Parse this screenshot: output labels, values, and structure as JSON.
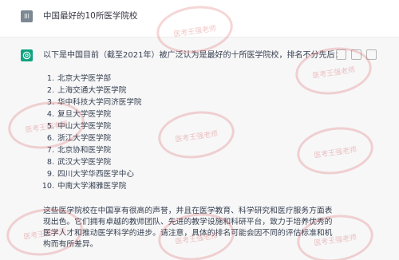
{
  "user": {
    "avatar_text": "Ill",
    "message": "中国最好的10所医学院校"
  },
  "assistant": {
    "intro": "以下是中国目前（截至2021年）被广泛认为是最好的十所医学院校，排名不分先后：",
    "list": [
      {
        "num": "1.",
        "text": "北京大学医学部"
      },
      {
        "num": "2.",
        "text": "上海交通大学医学院"
      },
      {
        "num": "3.",
        "text": "华中科技大学同济医学院"
      },
      {
        "num": "4.",
        "text": "复旦大学医学院"
      },
      {
        "num": "5.",
        "text": "中山大学医学院"
      },
      {
        "num": "6.",
        "text": "浙江大学医学院"
      },
      {
        "num": "7.",
        "text": "北京协和医学院"
      },
      {
        "num": "8.",
        "text": "武汉大学医学院"
      },
      {
        "num": "9.",
        "text": "四川大学华西医学中心"
      },
      {
        "num": "10.",
        "text": "中南大学湘雅医学院"
      }
    ],
    "paragraph": "这些医学院校在中国享有很高的声誉，并且在医学教育、科学研究和医疗服务方面表现出色。它们拥有卓越的教师团队、先进的教学设施和科研平台，致力于培养优秀的医学人才和推动医学科学的进步。请注意，具体的排名可能会因不同的评估标准和机构而有所差异。"
  },
  "watermark": {
    "text": "医考王强老师"
  }
}
